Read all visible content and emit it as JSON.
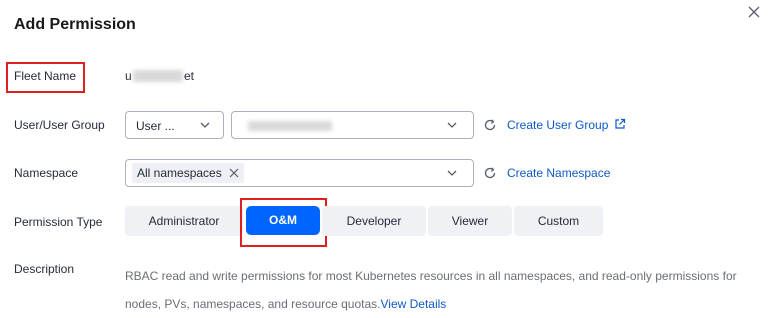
{
  "dialog": {
    "title": "Add Permission"
  },
  "fleet": {
    "label": "Fleet Name",
    "value_prefix": "u",
    "value_suffix": "et"
  },
  "user": {
    "label": "User/User Group",
    "type_value": "User ...",
    "create_link": "Create User Group"
  },
  "namespace": {
    "label": "Namespace",
    "tag": "All namespaces",
    "create_link": "Create Namespace"
  },
  "permission": {
    "label": "Permission Type",
    "options": [
      "Administrator",
      "O&M",
      "Developer",
      "Viewer",
      "Custom"
    ],
    "selected": "O&M"
  },
  "description": {
    "label": "Description",
    "text": "RBAC read and write permissions for most Kubernetes resources in all namespaces, and read-only permissions for nodes, PVs, namespaces, and resource quotas.",
    "link": "View Details"
  },
  "colors": {
    "accent": "#0065ff",
    "link": "#0e5ac8",
    "highlight_box": "#e02020"
  }
}
